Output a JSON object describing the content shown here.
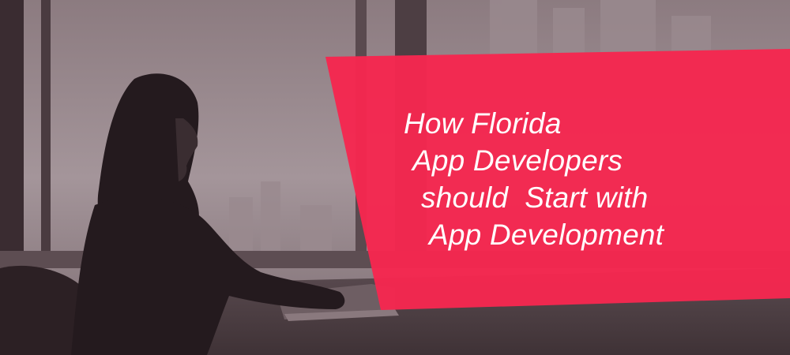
{
  "banner": {
    "headline_lines": [
      "How Florida",
      "App Developers",
      "should  Start with",
      "App Development"
    ]
  },
  "colors": {
    "panel": "#f5274f",
    "photo_tint": "#6f5f63",
    "text": "#ffffff"
  },
  "icons": {
    "silhouette": "person-at-laptop"
  }
}
